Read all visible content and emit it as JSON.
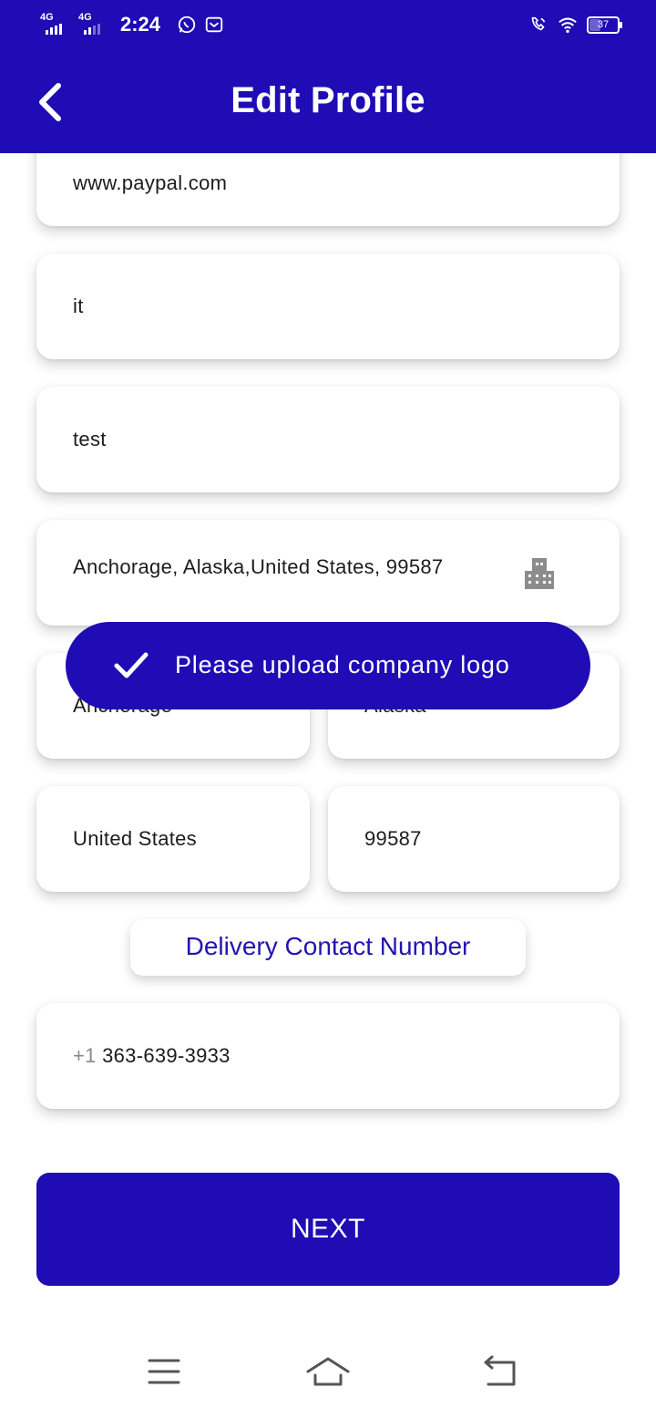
{
  "status_bar": {
    "network1": "4G",
    "network2": "4G",
    "time": "2:24",
    "battery": "37",
    "icons": [
      "signal-icon",
      "signal-icon",
      "whatsapp-icon",
      "mail-icon",
      "wifi-call-icon",
      "wifi-icon",
      "battery-icon"
    ]
  },
  "app_bar": {
    "title": "Edit Profile",
    "back_icon": "chevron-left-icon"
  },
  "form": {
    "website": "www.paypal.com",
    "industry": "it",
    "description": "test",
    "address": "Anchorage, Alaska,United States, 99587",
    "address_icon": "building-icon",
    "city": "Anchorage",
    "state": "Alaska",
    "country": "United States",
    "zip": "99587",
    "delivery_section_label": "Delivery Contact Number",
    "phone_country_code": "+1",
    "phone_number": "363-639-3933"
  },
  "toast": {
    "icon": "check-icon",
    "message": "Please upload company logo"
  },
  "actions": {
    "next_label": "NEXT"
  },
  "nav_bar": {
    "icons": [
      "menu-icon",
      "home-icon",
      "back-icon"
    ]
  },
  "colors": {
    "primary": "#1f0cb4",
    "section_label_text": "#2414b0",
    "card_bg": "#ffffff"
  }
}
